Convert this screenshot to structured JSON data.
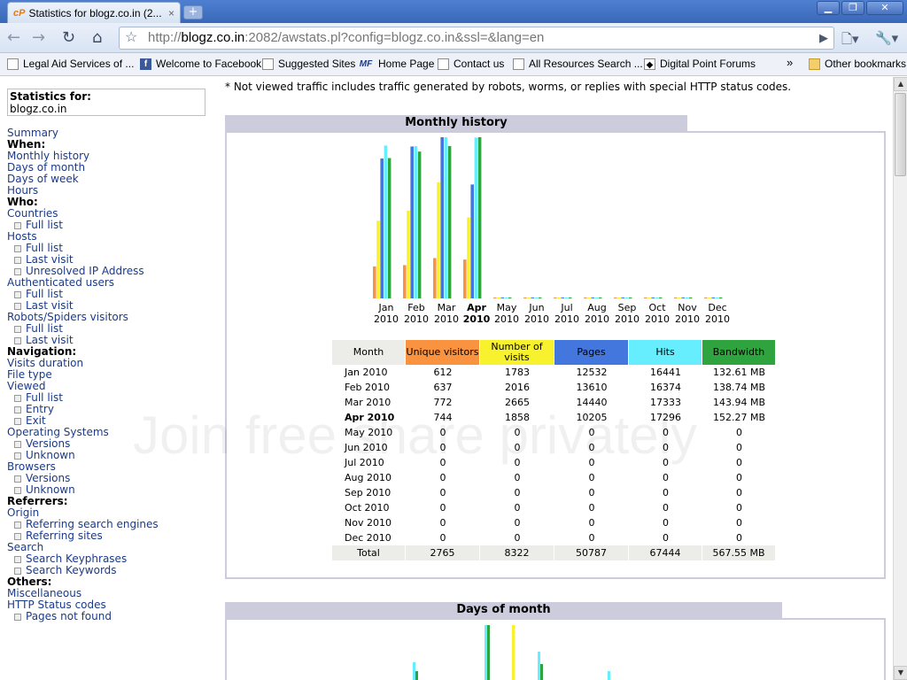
{
  "browser": {
    "tab_title": "Statistics for blogz.co.in (2...",
    "tab_close": "×",
    "new_tab": "+",
    "url_prefix": "http://",
    "url_host": "blogz.co.in",
    "url_rest": ":2082/awstats.pl?config=blogz.co.in&ssl=&lang=en"
  },
  "bookmarks": [
    {
      "label": "Legal Aid Services of ...",
      "icon": "page-icon"
    },
    {
      "label": "Welcome to Facebook",
      "icon": "facebook-icon"
    },
    {
      "label": "Suggested Sites",
      "icon": "page-icon"
    },
    {
      "label": "Home Page",
      "icon": "mf-icon"
    },
    {
      "label": "Contact us",
      "icon": "page-icon"
    },
    {
      "label": "All Resources Search ...",
      "icon": "page-icon"
    },
    {
      "label": "Digital Point Forums",
      "icon": "digitalpoint-icon"
    }
  ],
  "bookmarks_chevron": "»",
  "bookmarks_other": "Other bookmarks",
  "sidebar": {
    "stats_label": "Statistics for:",
    "site": "blogz.co.in",
    "items": [
      {
        "text": "Summary",
        "type": "link"
      },
      {
        "text": "When:",
        "type": "head"
      },
      {
        "text": "Monthly history",
        "type": "link"
      },
      {
        "text": "Days of month",
        "type": "link"
      },
      {
        "text": "Days of week",
        "type": "link"
      },
      {
        "text": "Hours",
        "type": "link"
      },
      {
        "text": "Who:",
        "type": "head"
      },
      {
        "text": "Countries",
        "type": "link"
      },
      {
        "text": "Full list",
        "type": "sub"
      },
      {
        "text": "Hosts",
        "type": "link"
      },
      {
        "text": "Full list",
        "type": "sub"
      },
      {
        "text": "Last visit",
        "type": "sub"
      },
      {
        "text": "Unresolved IP Address",
        "type": "sub"
      },
      {
        "text": "Authenticated users",
        "type": "link"
      },
      {
        "text": "Full list",
        "type": "sub"
      },
      {
        "text": "Last visit",
        "type": "sub"
      },
      {
        "text": "Robots/Spiders visitors",
        "type": "link"
      },
      {
        "text": "Full list",
        "type": "sub"
      },
      {
        "text": "Last visit",
        "type": "sub"
      },
      {
        "text": "Navigation:",
        "type": "head"
      },
      {
        "text": "Visits duration",
        "type": "link"
      },
      {
        "text": "File type",
        "type": "link"
      },
      {
        "text": "Viewed",
        "type": "link"
      },
      {
        "text": "Full list",
        "type": "sub"
      },
      {
        "text": "Entry",
        "type": "sub"
      },
      {
        "text": "Exit",
        "type": "sub"
      },
      {
        "text": "Operating Systems",
        "type": "link"
      },
      {
        "text": "Versions",
        "type": "sub"
      },
      {
        "text": "Unknown",
        "type": "sub"
      },
      {
        "text": "Browsers",
        "type": "link"
      },
      {
        "text": "Versions",
        "type": "sub"
      },
      {
        "text": "Unknown",
        "type": "sub"
      },
      {
        "text": "Referrers:",
        "type": "head"
      },
      {
        "text": "Origin",
        "type": "link"
      },
      {
        "text": "Referring search engines",
        "type": "sub"
      },
      {
        "text": "Referring sites",
        "type": "sub"
      },
      {
        "text": "Search",
        "type": "link"
      },
      {
        "text": "Search Keyphrases",
        "type": "sub"
      },
      {
        "text": "Search Keywords",
        "type": "sub"
      },
      {
        "text": "Others:",
        "type": "head"
      },
      {
        "text": "Miscellaneous",
        "type": "link"
      },
      {
        "text": "HTTP Status codes",
        "type": "link"
      },
      {
        "text": "Pages not found",
        "type": "sub"
      }
    ]
  },
  "main": {
    "notice": "* Not viewed traffic includes traffic generated by robots, worms, or replies with special HTTP status codes.",
    "monthly_title": "Monthly history",
    "days_title": "Days of month",
    "watermark": "Join free share privately"
  },
  "chart_data": {
    "type": "bar",
    "categories": [
      "Jan 2010",
      "Feb 2010",
      "Mar 2010",
      "Apr 2010",
      "May 2010",
      "Jun 2010",
      "Jul 2010",
      "Aug 2010",
      "Sep 2010",
      "Oct 2010",
      "Nov 2010",
      "Dec 2010"
    ],
    "category_month": [
      "Jan",
      "Feb",
      "Mar",
      "Apr",
      "May",
      "Jun",
      "Jul",
      "Aug",
      "Sep",
      "Oct",
      "Nov",
      "Dec"
    ],
    "category_year": [
      "2010",
      "2010",
      "2010",
      "2010",
      "2010",
      "2010",
      "2010",
      "2010",
      "2010",
      "2010",
      "2010",
      "2010"
    ],
    "bold_index": 3,
    "series": [
      {
        "name": "Unique visitors",
        "color": "#f9933f",
        "values": [
          612,
          637,
          772,
          744,
          0,
          0,
          0,
          0,
          0,
          0,
          0,
          0
        ]
      },
      {
        "name": "Number of visits",
        "color": "#f8f12d",
        "values": [
          1783,
          2016,
          2665,
          1858,
          0,
          0,
          0,
          0,
          0,
          0,
          0,
          0
        ]
      },
      {
        "name": "Pages",
        "color": "#4477dd",
        "values": [
          12532,
          13610,
          14440,
          10205,
          0,
          0,
          0,
          0,
          0,
          0,
          0,
          0
        ]
      },
      {
        "name": "Hits",
        "color": "#66eeff",
        "values": [
          16441,
          16374,
          17333,
          17296,
          0,
          0,
          0,
          0,
          0,
          0,
          0,
          0
        ]
      },
      {
        "name": "Bandwidth",
        "color": "#2ea33e",
        "values": [
          132.61,
          138.74,
          143.94,
          152.27,
          0,
          0,
          0,
          0,
          0,
          0,
          0,
          0
        ]
      }
    ],
    "table": {
      "headers": [
        "Month",
        "Unique visitors",
        "Number of visits",
        "Pages",
        "Hits",
        "Bandwidth"
      ],
      "bandwidth_text": [
        "132.61 MB",
        "138.74 MB",
        "143.94 MB",
        "152.27 MB",
        "0",
        "0",
        "0",
        "0",
        "0",
        "0",
        "0",
        "0"
      ],
      "total": [
        "Total",
        "2765",
        "8322",
        "50787",
        "67444",
        "567.55 MB"
      ]
    }
  }
}
